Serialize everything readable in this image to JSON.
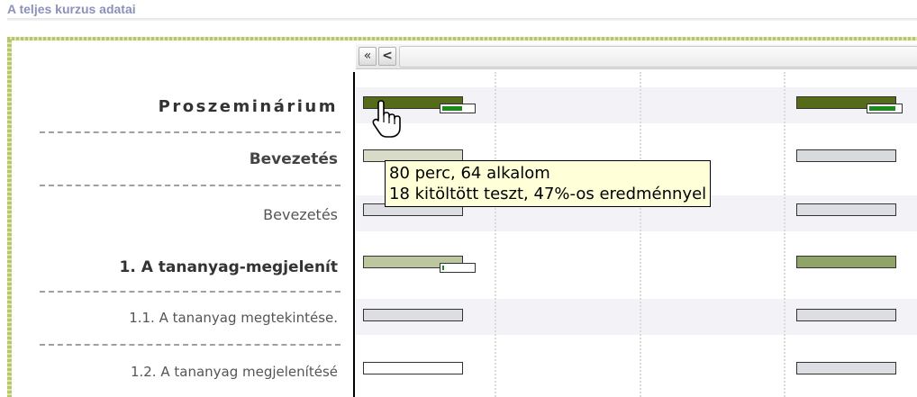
{
  "page_title": "A teljes kurzus adatai",
  "nav": {
    "first_label": "«",
    "prev_label": "<"
  },
  "rows": [
    {
      "label": "Proszeminárium",
      "bar_colors": [
        "#556b1a",
        "#556b1a"
      ],
      "progress": [
        0.64,
        0.85
      ]
    },
    {
      "label": "Bevezetés",
      "bar_colors": [
        "#d9dbc9",
        "#d8dbde"
      ]
    },
    {
      "label": "Bevezetés",
      "bar_colors": [
        "#dcdee4",
        "#dcdee4"
      ]
    },
    {
      "label": "1. A tananyag-megjelenít",
      "bar_colors": [
        "#bcc79f",
        "#8fa466"
      ],
      "progress": [
        0.05,
        null
      ]
    },
    {
      "label": "1.1. A tananyag megtekintése.",
      "bar_colors": [
        "#dcdee4",
        "#dcdee4"
      ]
    },
    {
      "label": "1.2. A tananyag megjelenítésé",
      "bar_colors": [
        "#ffffff",
        "#dcdee4"
      ]
    }
  ],
  "tooltip": {
    "line1": "80 perc, 64 alkalom",
    "line2": "18 kitöltött teszt, 47%-os eredménnyel"
  },
  "icons": {
    "cursor": "hand-pointer-icon"
  },
  "colors": {
    "title": "#8c91b8",
    "axis": "#000000",
    "tooltip_bg": "#ffffd8"
  }
}
